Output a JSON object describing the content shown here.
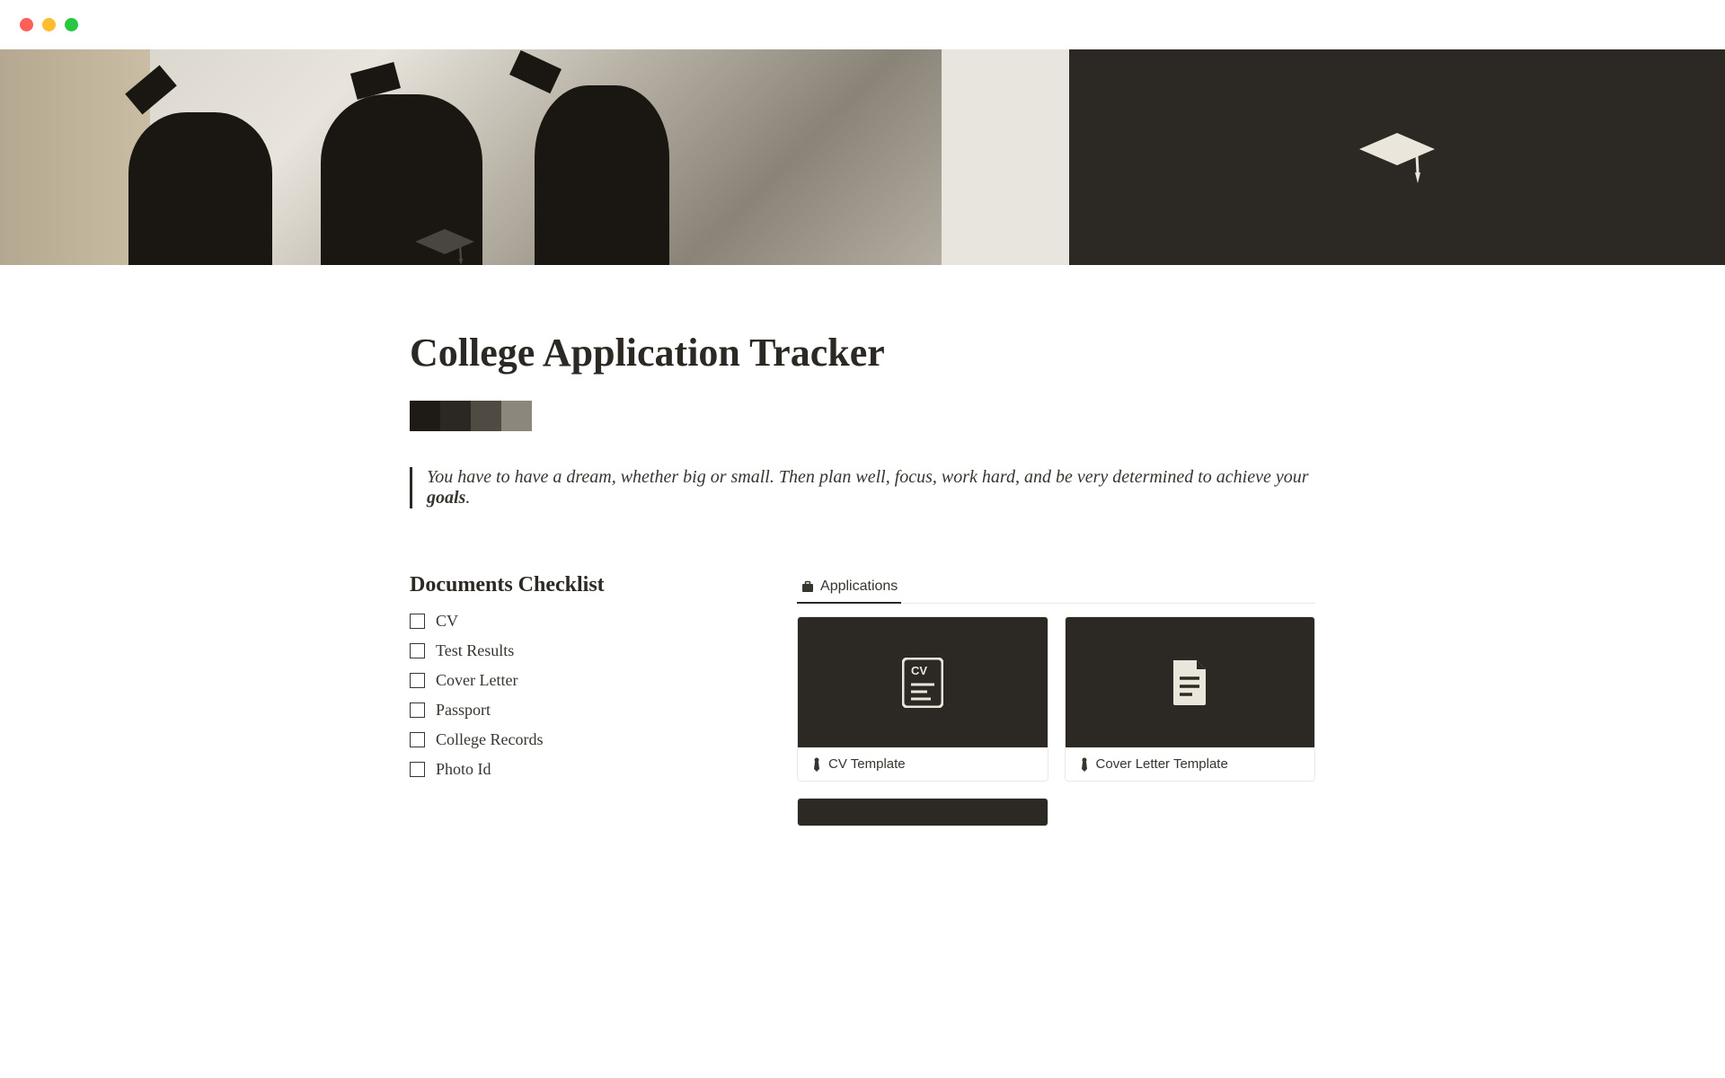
{
  "page": {
    "title": "College Application Tracker",
    "quote_prefix": "You have to have a dream, whether big or small. Then plan well, focus, work hard, and be very determined to achieve your ",
    "quote_bold": "goals",
    "quote_suffix": "."
  },
  "swatches": [
    "#1e1b17",
    "#2b2824",
    "#4f4a42",
    "#8c877d"
  ],
  "checklist": {
    "heading": "Documents Checklist",
    "items": [
      "CV",
      "Test Results",
      "Cover Letter",
      "Passport",
      "College Records",
      "Photo Id"
    ]
  },
  "gallery": {
    "tab_label": "Applications",
    "cards": [
      {
        "title": "CV Template",
        "icon": "cv"
      },
      {
        "title": "Cover Letter Template",
        "icon": "doc"
      }
    ]
  }
}
